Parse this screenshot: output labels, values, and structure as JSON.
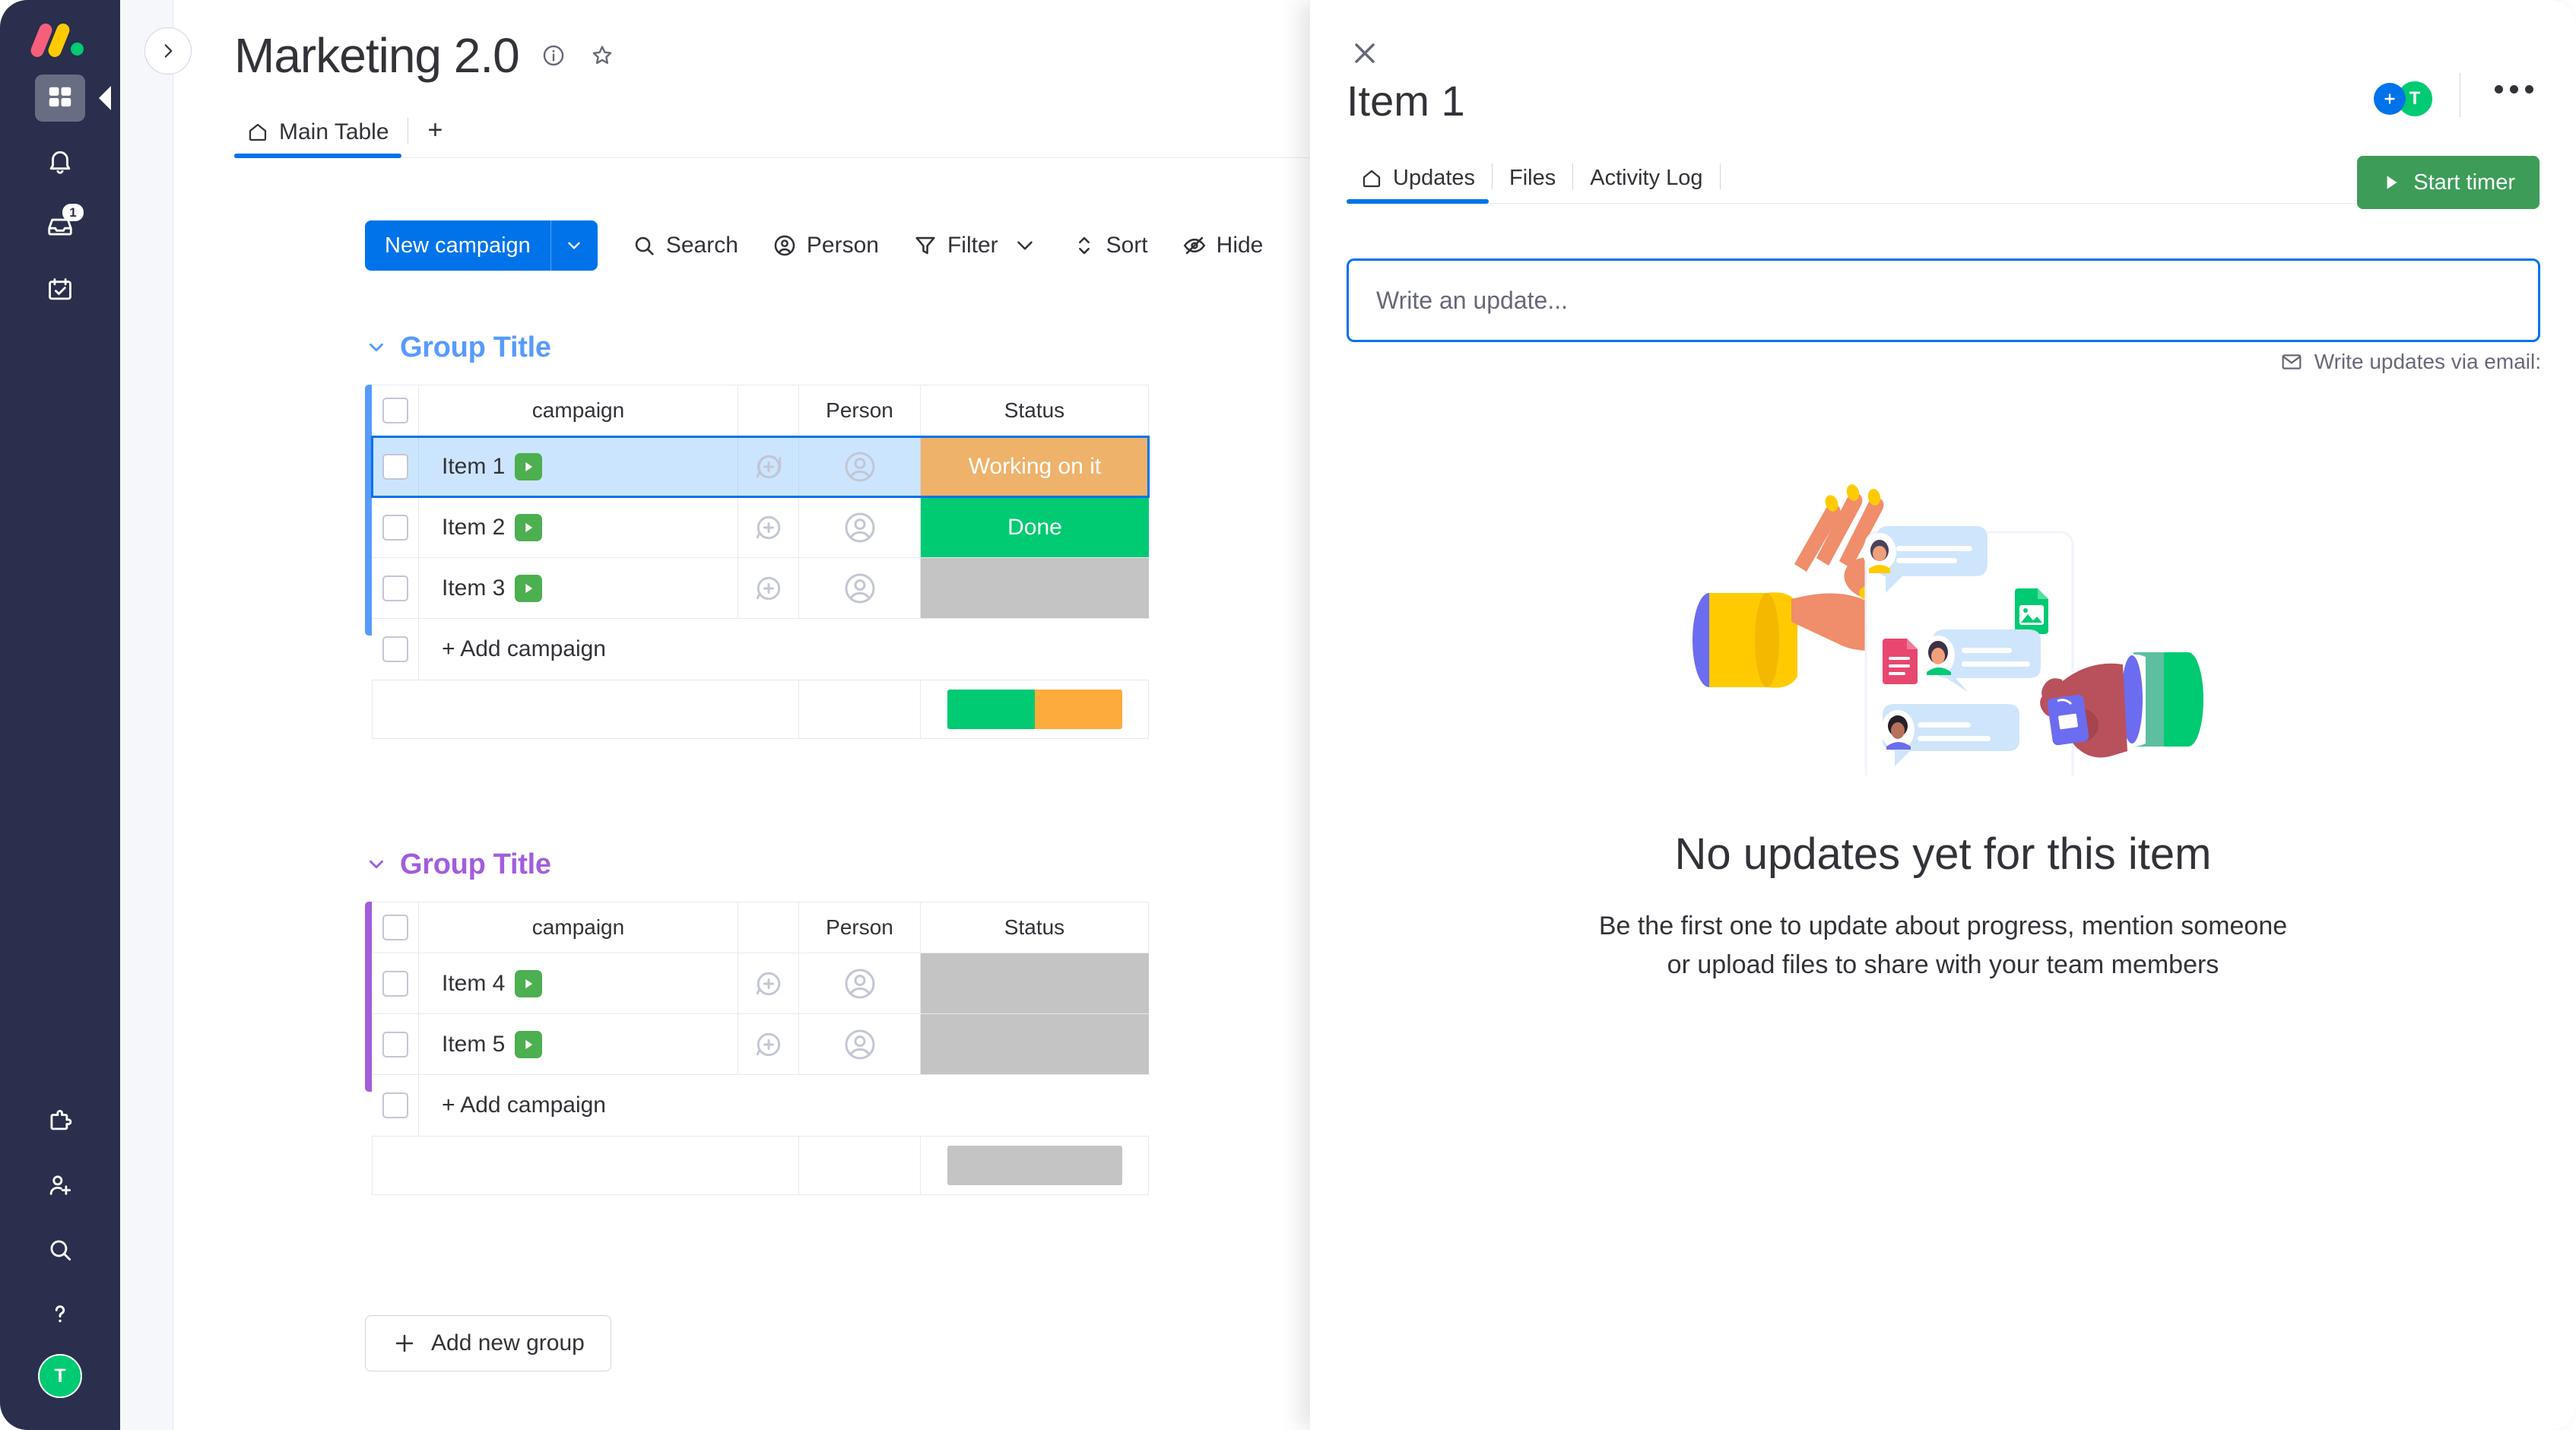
{
  "rail": {
    "logo": "monday-logo",
    "items": [
      {
        "icon": "grid-icon",
        "name": "home",
        "active": true,
        "badge": ""
      },
      {
        "icon": "bell-icon",
        "name": "notifications",
        "active": false,
        "badge": ""
      },
      {
        "icon": "inbox-icon",
        "name": "inbox",
        "active": false,
        "badge": "1"
      },
      {
        "icon": "my-work-icon",
        "name": "my-work",
        "active": false,
        "badge": ""
      }
    ],
    "bottom_items": [
      {
        "icon": "puzzle-icon",
        "name": "apps"
      },
      {
        "icon": "invite-person-icon",
        "name": "invite-members"
      },
      {
        "icon": "search-icon",
        "name": "search"
      },
      {
        "icon": "help-icon",
        "name": "help"
      }
    ],
    "avatar_initial": "T"
  },
  "board": {
    "title": "Marketing 2.0",
    "info_icon": "info-icon",
    "favorite_icon": "star-icon",
    "collapse_icon": "chevron-right-icon",
    "tabs": [
      {
        "label": "Main Table",
        "icon": "home-icon",
        "active": true
      }
    ],
    "add_tab_label": "+",
    "toolbar": {
      "new_button": "New campaign",
      "new_button_caret": "chevron-down-icon",
      "items": [
        {
          "label": "Search",
          "icon": "search-icon",
          "caret": false
        },
        {
          "label": "Person",
          "icon": "person-icon",
          "caret": false
        },
        {
          "label": "Filter",
          "icon": "filter-icon",
          "caret": true
        },
        {
          "label": "Sort",
          "icon": "sort-icon",
          "caret": false
        },
        {
          "label": "Hide",
          "icon": "eye-off-icon",
          "caret": false
        }
      ]
    },
    "columns": [
      "campaign",
      "Person",
      "Status"
    ],
    "add_row_label": "+ Add campaign",
    "add_group_label": "Add new group",
    "groups": [
      {
        "title": "Group Title",
        "color": "#579bfc",
        "rows": [
          {
            "name": "Item 1",
            "status": "Working on it",
            "status_color": "#eeb26a",
            "selected": true
          },
          {
            "name": "Item 2",
            "status": "Done",
            "status_color": "#00ca72",
            "selected": false
          },
          {
            "name": "Item 3",
            "status": "",
            "status_color": "#c4c4c4",
            "selected": false
          }
        ],
        "summary": [
          {
            "color": "#00ca72",
            "pct": 50
          },
          {
            "color": "#fdab3d",
            "pct": 50
          }
        ]
      },
      {
        "title": "Group Title",
        "color": "#a25ddc",
        "rows": [
          {
            "name": "Item 4",
            "status": "",
            "status_color": "#c4c4c4",
            "selected": false
          },
          {
            "name": "Item 5",
            "status": "",
            "status_color": "#c4c4c4",
            "selected": false
          }
        ],
        "summary": [
          {
            "color": "#c4c4c4",
            "pct": 100
          }
        ]
      }
    ]
  },
  "panel": {
    "close_icon": "close-icon",
    "title": "Item 1",
    "add_person_icon": "plus-icon",
    "avatar_initial": "T",
    "more_icon": "more-horizontal-icon",
    "tabs": [
      {
        "label": "Updates",
        "icon": "home-icon",
        "active": true
      },
      {
        "label": "Files",
        "icon": "",
        "active": false
      },
      {
        "label": "Activity Log",
        "icon": "",
        "active": false
      }
    ],
    "start_timer_label": "Start timer",
    "start_timer_icon": "play-icon",
    "start_timer_color": "#3d9c58",
    "update_placeholder": "Write an update...",
    "via_email_label": "Write updates via email:",
    "via_email_icon": "mail-icon",
    "empty_title": "No updates yet for this item",
    "empty_body_line1": "Be the first one to update about progress, mention someone",
    "empty_body_line2": "or upload files to share with your team members",
    "illustration": "updates-empty-state-illustration"
  },
  "colors": {
    "accent_blue": "#0073ea",
    "green": "#00ca72",
    "orange": "#fdab3d",
    "gray": "#c4c4c4",
    "rail_bg": "#292f4c"
  }
}
